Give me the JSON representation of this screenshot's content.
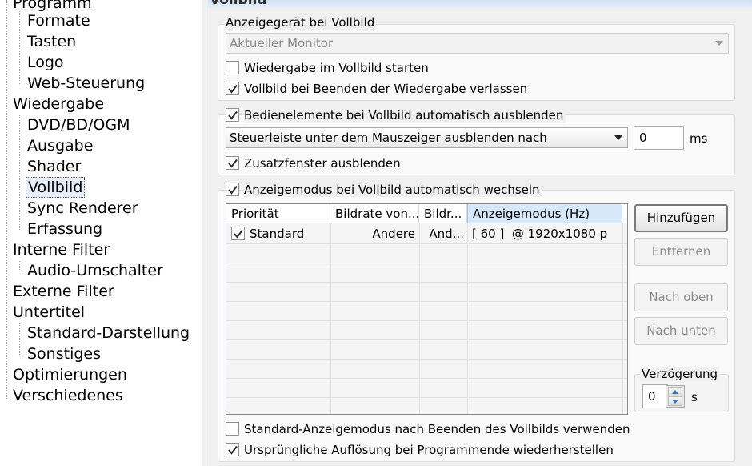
{
  "tree": {
    "items": [
      {
        "label": "Programm",
        "level": 0
      },
      {
        "label": "Formate",
        "level": 1
      },
      {
        "label": "Tasten",
        "level": 1
      },
      {
        "label": "Logo",
        "level": 1
      },
      {
        "label": "Web-Steuerung",
        "level": 1
      },
      {
        "label": "Wiedergabe",
        "level": 0
      },
      {
        "label": "DVD/BD/OGM",
        "level": 1
      },
      {
        "label": "Ausgabe",
        "level": 1
      },
      {
        "label": "Shader",
        "level": 1
      },
      {
        "label": "Vollbild",
        "level": 1,
        "selected": true
      },
      {
        "label": "Sync Renderer",
        "level": 1
      },
      {
        "label": "Erfassung",
        "level": 1
      },
      {
        "label": "Interne Filter",
        "level": 0
      },
      {
        "label": "Audio-Umschalter",
        "level": 1
      },
      {
        "label": "Externe Filter",
        "level": 0
      },
      {
        "label": "Untertitel",
        "level": 0
      },
      {
        "label": "Standard-Darstellung",
        "level": 1
      },
      {
        "label": "Sonstiges",
        "level": 1
      },
      {
        "label": "Optimierungen",
        "level": 0
      },
      {
        "label": "Verschiedenes",
        "level": 0
      }
    ]
  },
  "page": {
    "title": "Vollbild"
  },
  "device_group": {
    "label": "Anzeigegerät bei Vollbild",
    "monitor_value": "Aktueller Monitor",
    "start_fullscreen": {
      "label": "Wiedergabe im Vollbild starten",
      "checked": false
    },
    "leave_fullscreen": {
      "label": "Vollbild bei Beenden der Wiedergabe verlassen",
      "checked": true
    }
  },
  "controls_group": {
    "autohide": {
      "label": "Bedienelemente bei Vollbild automatisch ausblenden",
      "checked": true
    },
    "hide_mode_value": "Steuerleiste unter dem Mauszeiger ausblenden nach",
    "delay_value": "0",
    "delay_unit": "ms",
    "hide_panels": {
      "label": "Zusatzfenster ausblenden",
      "checked": true
    }
  },
  "mode_group": {
    "autoswitch": {
      "label": "Anzeigemodus bei Vollbild automatisch wechseln",
      "checked": true
    },
    "columns": [
      "Priorität",
      "Bildrate von...",
      "Bildr...",
      "Anzeigemodus (Hz)"
    ],
    "rows": [
      {
        "checked": true,
        "priority": "Standard",
        "rate_from": "Andere",
        "rate_to": "And...",
        "mode": "[ 60 ]  @ 1920x1080 p"
      }
    ],
    "buttons": {
      "add": "Hinzufügen",
      "remove": "Entfernen",
      "up": "Nach oben",
      "down": "Nach unten"
    },
    "delay_label": "Verzögerung",
    "delay_value": "0",
    "delay_unit": "s",
    "use_default_mode": {
      "label": "Standard-Anzeigemodus nach Beenden des Vollbilds verwenden",
      "checked": false
    },
    "restore_resolution": {
      "label": "Ursprüngliche Auflösung bei Programmende wiederherstellen",
      "checked": true
    }
  },
  "colors": {
    "accent": "#3b6fb6",
    "panel": "#f0f0f0",
    "header_sorted": "#d8e8fb"
  }
}
